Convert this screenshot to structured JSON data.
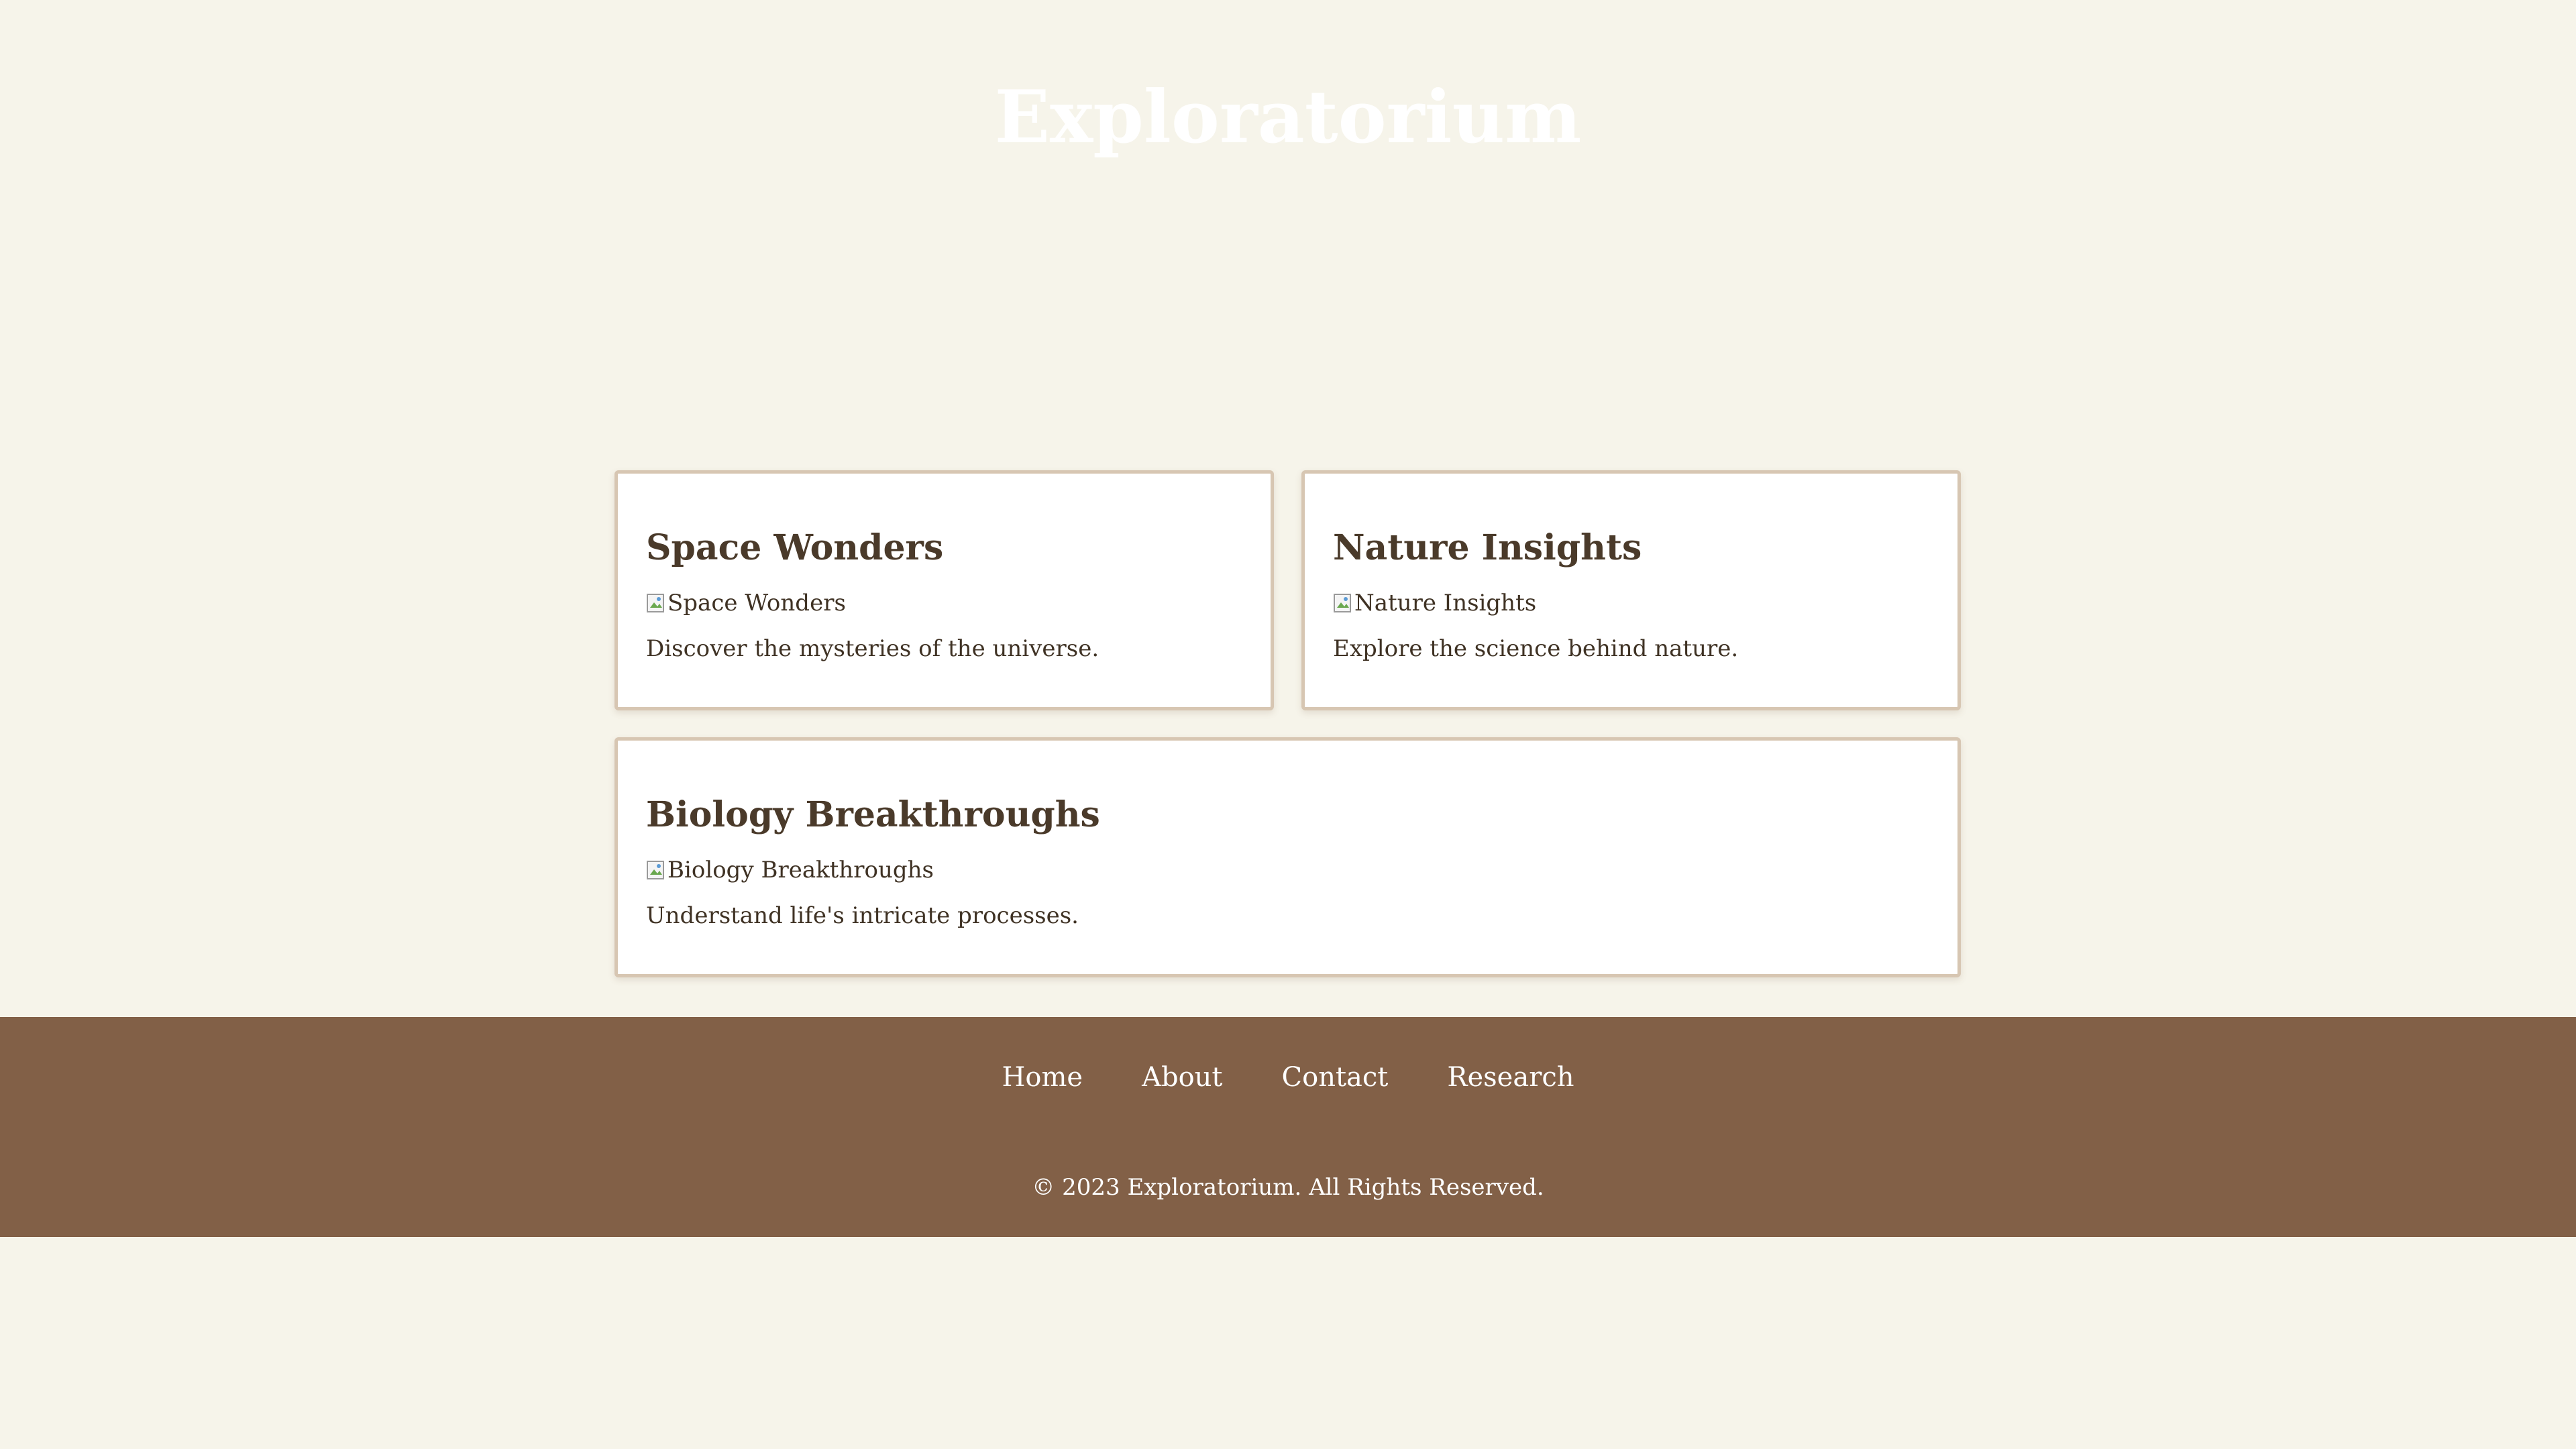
{
  "header": {
    "title": "Exploratorium"
  },
  "cards": [
    {
      "title": "Space Wonders",
      "image_alt": "Space Wonders",
      "description": "Discover the mysteries of the universe."
    },
    {
      "title": "Nature Insights",
      "image_alt": "Nature Insights",
      "description": "Explore the science behind nature."
    },
    {
      "title": "Biology Breakthroughs",
      "image_alt": "Biology Breakthroughs",
      "description": "Understand life's intricate processes."
    }
  ],
  "footer": {
    "nav": [
      "Home",
      "About",
      "Contact",
      "Research"
    ],
    "copyright": "© 2023 Exploratorium. All Rights Reserved."
  },
  "colors": {
    "background": "#f6f4ea",
    "footer_background": "#826047",
    "heading_text": "#4a3a2a",
    "card_border": "#d7c6b2"
  },
  "icons": {
    "broken_image": "broken-image-icon"
  }
}
